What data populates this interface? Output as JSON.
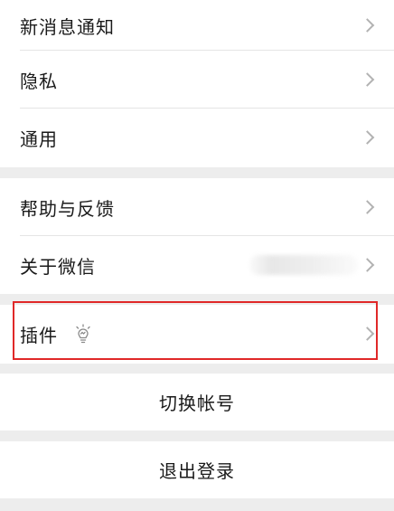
{
  "settings_group_1": {
    "notifications_label": "新消息通知",
    "privacy_label": "隐私",
    "general_label": "通用"
  },
  "settings_group_2": {
    "help_label": "帮助与反馈",
    "about_label": "关于微信"
  },
  "settings_group_3": {
    "plugins_label": "插件"
  },
  "actions": {
    "switch_account_label": "切换帐号",
    "logout_label": "退出登录"
  },
  "colors": {
    "highlight": "#e02828",
    "background": "#ededed"
  }
}
